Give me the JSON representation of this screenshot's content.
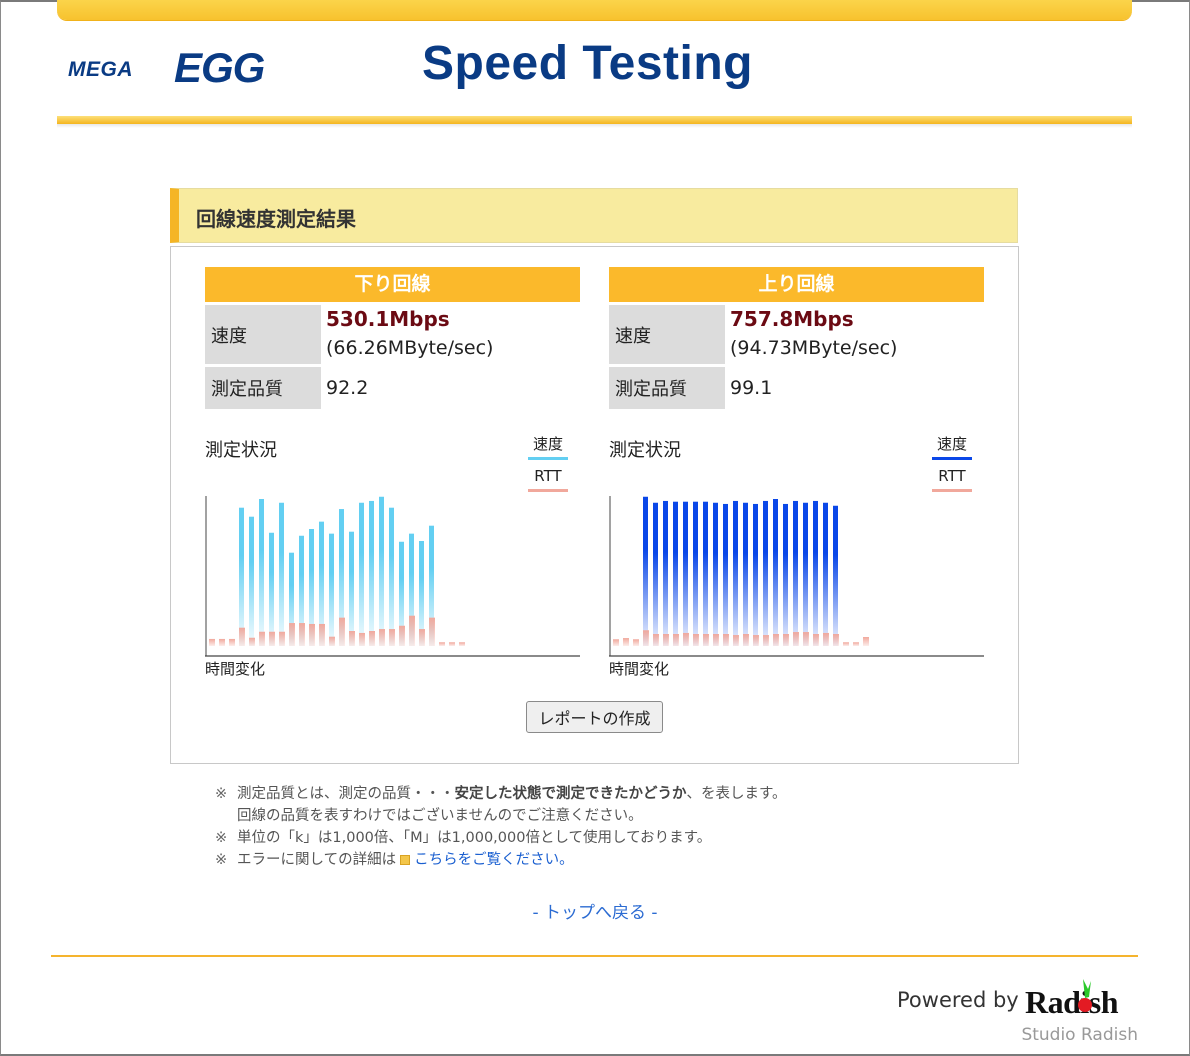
{
  "header": {
    "logo_text_small": "MEGA",
    "logo_text_large": "EGG",
    "title": "Speed Testing"
  },
  "section": {
    "title": "回線速度測定結果"
  },
  "results": [
    {
      "id": "down",
      "heading": "下り回線",
      "speed_label": "速度",
      "speed_mbps": "530.1Mbps",
      "speed_mbyte": "(66.26MByte/sec)",
      "quality_label": "測定品質",
      "quality_value": "92.2"
    },
    {
      "id": "up",
      "heading": "上り回線",
      "speed_label": "速度",
      "speed_mbps": "757.8Mbps",
      "speed_mbyte": "(94.73MByte/sec)",
      "quality_label": "測定品質",
      "quality_value": "99.1"
    }
  ],
  "colors": {
    "download_speed": "#63cff2",
    "upload_speed": "#0a47e8",
    "rtt": "#f1a89c",
    "accent": "#fbb92b",
    "title_blue": "#0a3b84",
    "mbps_red": "#6b0a13"
  },
  "chart_data": [
    {
      "type": "bar",
      "title": "測定状況",
      "xlabel": "時間変化",
      "ylabel": "",
      "legend": [
        "速度",
        "RTT"
      ],
      "legend_position": "top-right",
      "ylim": [
        0,
        100
      ],
      "series": [
        {
          "name": "速度",
          "start_index": 3,
          "values": [
            92.2,
            86.2,
            98.0,
            75.5,
            95.5,
            62.2,
            73.5,
            78.0,
            82.9,
            74.9,
            91.3,
            76.2,
            95.5,
            96.7,
            99.5,
            92.2,
            69.5,
            74.9,
            70.0,
            80.2
          ]
        },
        {
          "name": "RTT",
          "start_index": 0,
          "values": [
            4.7,
            4.7,
            4.7,
            12.2,
            5.5,
            9.5,
            9.5,
            9.5,
            15.3,
            15.3,
            14.7,
            14.7,
            6.2,
            18.9,
            10.0,
            8.7,
            10.0,
            11.3,
            11.3,
            13.5,
            20.2,
            11.3,
            18.9,
            2.5,
            2.5,
            2.5
          ]
        }
      ]
    },
    {
      "type": "bar",
      "title": "測定状況",
      "xlabel": "時間変化",
      "ylabel": "",
      "legend": [
        "速度",
        "RTT"
      ],
      "legend_position": "top-right",
      "ylim": [
        0,
        100
      ],
      "series": [
        {
          "name": "速度",
          "start_index": 3,
          "values": [
            99.5,
            95.5,
            96.7,
            96.2,
            96.2,
            96.2,
            96.2,
            95.5,
            94.7,
            96.7,
            95.5,
            94.7,
            96.7,
            98.0,
            94.7,
            96.7,
            95.5,
            96.7,
            95.5,
            93.5
          ]
        },
        {
          "name": "RTT",
          "start_index": 0,
          "values": [
            4.5,
            5.3,
            4.5,
            10.5,
            8.0,
            8.0,
            8.0,
            8.7,
            8.0,
            8.0,
            8.0,
            8.0,
            7.3,
            8.0,
            7.3,
            7.3,
            8.0,
            8.0,
            9.3,
            9.3,
            8.0,
            8.7,
            8.0,
            2.5,
            2.5,
            6.0
          ]
        }
      ]
    }
  ],
  "report_button": "レポートの作成",
  "notes": {
    "mark": "※",
    "note1_a": "測定品質とは、測定の品質・・・",
    "note1_bold": "安定した状態で測定できたかどうか",
    "note1_b": "、を表します。",
    "note1_line2": "回線の品質を表すわけではございませんのでご注意ください。",
    "note2": "単位の「k」は1,000倍、「M」は1,000,000倍として使用しております。",
    "note3_text": "エラーに関しての詳細は",
    "note3_link": "こちらをご覧ください。"
  },
  "back_link": "- トップへ戻る -",
  "footer": {
    "powered_by": "Powered by",
    "brand": "Radish",
    "studio": "Studio Radish"
  }
}
